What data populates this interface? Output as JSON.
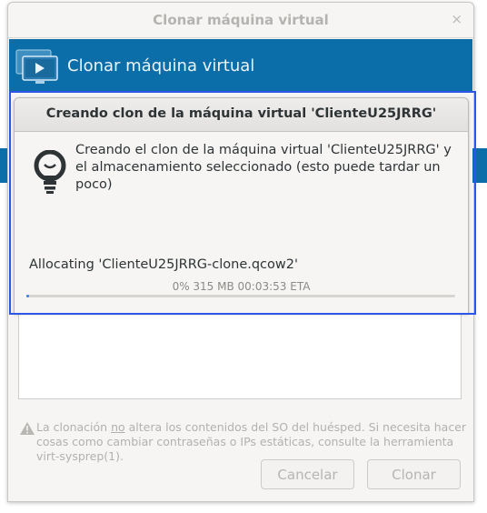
{
  "outer_dialog": {
    "title": "Clonar máquina virtual",
    "close_glyph": "×",
    "header_label": "Clonar máquina virtual",
    "header_icon": "monitor-icon",
    "warning_icon": "warning-icon",
    "warning_before": "La clonación ",
    "warning_underlined": "no",
    "warning_after": " altera los contenidos del SO del huésped. Si necesita hacer cosas como cambiar contraseñas o IPs estáticas, consulte la herramienta virt-sysprep(1).",
    "cancel_label": "Cancelar",
    "clone_label": "Clonar",
    "accent_color": "#0b6ea8"
  },
  "progress_dialog": {
    "title": "Creando clon de la máquina virtual 'ClienteU25JRRG'",
    "icon": "lightbulb-icon",
    "message": "Creando el clon de la máquina virtual 'ClienteU25JRRG' y el almacenamiento seleccionado (esto puede tardar un poco)",
    "status": "Allocating 'ClienteU25JRRG-clone.qcow2'",
    "progress_text": "0% 315 MB 00:03:53 ETA",
    "progress_fraction": 0.0,
    "highlight_color": "#2b56e8"
  }
}
